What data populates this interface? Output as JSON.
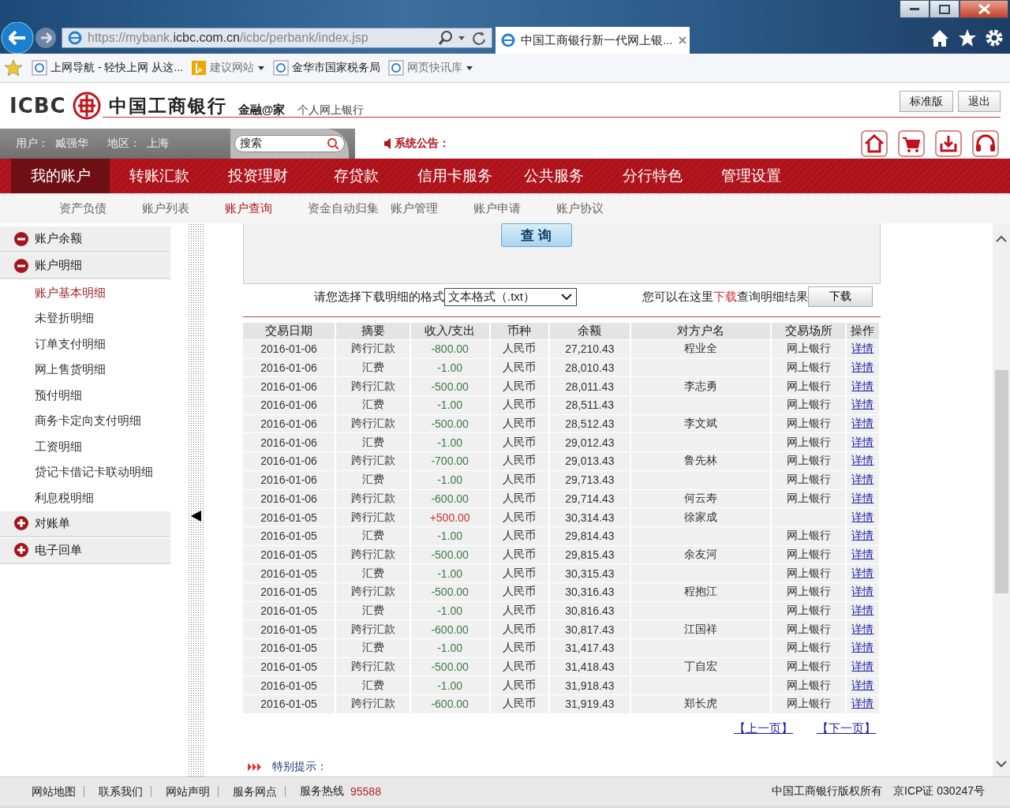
{
  "browser": {
    "url": "https://mybank.**icbc.com.cn**/icbc/perbank/index.jsp",
    "tab": "中国工商银行新一代网上银...",
    "favorites": [
      {
        "label": "上网导航 - 轻快上网 从这...",
        "dropdown": false
      },
      {
        "label": "建议网站",
        "dropdown": true
      },
      {
        "label": "金华市国家税务局",
        "dropdown": false
      },
      {
        "label": "网页快讯库",
        "dropdown": true
      }
    ]
  },
  "header": {
    "logo": "ICBC",
    "bank_name": "中国工商银行",
    "brand": "金融@家",
    "product": "个人网上银行",
    "buttons": [
      "标准版",
      "退出"
    ]
  },
  "user_bar": {
    "user_label": "用户：",
    "user": "臧强华",
    "region_label": "地区：",
    "region": "上海",
    "search_placeholder": "搜索",
    "notice": "系统公告："
  },
  "nav": [
    {
      "label": "我的账户",
      "selected": true
    },
    {
      "label": "转账汇款",
      "selected": false
    },
    {
      "label": "投资理财",
      "selected": false
    },
    {
      "label": "存贷款",
      "selected": false
    },
    {
      "label": "信用卡服务",
      "selected": false
    },
    {
      "label": "公共服务",
      "selected": false
    },
    {
      "label": "分行特色",
      "selected": false
    },
    {
      "label": "管理设置",
      "selected": false
    }
  ],
  "subnav": [
    {
      "label": "资产负债",
      "selected": false
    },
    {
      "label": "账户列表",
      "selected": false
    },
    {
      "label": "账户查询",
      "selected": true
    },
    {
      "label": "资金自动归集",
      "selected": false
    },
    {
      "label": "账户管理",
      "selected": false
    },
    {
      "label": "账户申请",
      "selected": false
    },
    {
      "label": "账户协议",
      "selected": false
    }
  ],
  "sidebar": [
    {
      "label": "账户余额",
      "expanded": true
    },
    {
      "label": "账户明细",
      "expanded": true,
      "children": [
        {
          "label": "账户基本明细",
          "selected": true
        },
        {
          "label": "未登折明细",
          "selected": false
        },
        {
          "label": "订单支付明细",
          "selected": false
        },
        {
          "label": "网上售货明细",
          "selected": false
        },
        {
          "label": "预付明细",
          "selected": false
        },
        {
          "label": "商务卡定向支付明细",
          "selected": false
        },
        {
          "label": "工资明细",
          "selected": false
        },
        {
          "label": "贷记卡借记卡联动明细",
          "selected": false
        },
        {
          "label": "利息税明细",
          "selected": false
        }
      ]
    },
    {
      "label": "对账单",
      "expanded": false
    },
    {
      "label": "电子回单",
      "expanded": false
    }
  ],
  "query": {
    "button": "查 询",
    "format_label": "请您选择下载明细的格式",
    "format": "文本格式（.txt）",
    "hint_before": "您可以在这里",
    "hint_link": "下载",
    "hint_after": "查询明细结果",
    "download_button": "下载"
  },
  "table": {
    "columns": [
      "交易日期",
      "摘要",
      "收入/支出",
      "币种",
      "余额",
      "对方户名",
      "交易场所",
      "操作"
    ],
    "rows": [
      {
        "date": "2016-01-06",
        "summary": "跨行汇款",
        "amount": "-800.00",
        "kind": "debit",
        "currency": "人民币",
        "balance": "27,210.43",
        "counterparty": "程业全",
        "place": "网上银行",
        "action": "详情"
      },
      {
        "date": "2016-01-06",
        "summary": "汇费",
        "amount": "-1.00",
        "kind": "debit",
        "currency": "人民币",
        "balance": "28,010.43",
        "place": "网上银行",
        "action": "详情"
      },
      {
        "date": "2016-01-06",
        "summary": "跨行汇款",
        "amount": "-500.00",
        "kind": "debit",
        "currency": "人民币",
        "balance": "28,011.43",
        "counterparty": "李志勇",
        "place": "网上银行",
        "action": "详情"
      },
      {
        "date": "2016-01-06",
        "summary": "汇费",
        "amount": "-1.00",
        "kind": "debit",
        "currency": "人民币",
        "balance": "28,511.43",
        "place": "网上银行",
        "action": "详情"
      },
      {
        "date": "2016-01-06",
        "summary": "跨行汇款",
        "amount": "-500.00",
        "kind": "debit",
        "currency": "人民币",
        "balance": "28,512.43",
        "counterparty": "李文斌",
        "place": "网上银行",
        "action": "详情"
      },
      {
        "date": "2016-01-06",
        "summary": "汇费",
        "amount": "-1.00",
        "kind": "debit",
        "currency": "人民币",
        "balance": "29,012.43",
        "place": "网上银行",
        "action": "详情"
      },
      {
        "date": "2016-01-06",
        "summary": "跨行汇款",
        "amount": "-700.00",
        "kind": "debit",
        "currency": "人民币",
        "balance": "29,013.43",
        "counterparty": "鲁先林",
        "place": "网上银行",
        "action": "详情"
      },
      {
        "date": "2016-01-06",
        "summary": "汇费",
        "amount": "-1.00",
        "kind": "debit",
        "currency": "人民币",
        "balance": "29,713.43",
        "place": "网上银行",
        "action": "详情"
      },
      {
        "date": "2016-01-06",
        "summary": "跨行汇款",
        "amount": "-600.00",
        "kind": "debit",
        "currency": "人民币",
        "balance": "29,714.43",
        "counterparty": "何云寿",
        "place": "网上银行",
        "action": "详情"
      },
      {
        "date": "2016-01-05",
        "summary": "跨行汇款",
        "amount": "+500.00",
        "kind": "credit",
        "currency": "人民币",
        "balance": "30,314.43",
        "counterparty": "徐家成",
        "action": "详情"
      },
      {
        "date": "2016-01-05",
        "summary": "汇费",
        "amount": "-1.00",
        "kind": "debit",
        "currency": "人民币",
        "balance": "29,814.43",
        "place": "网上银行",
        "action": "详情"
      },
      {
        "date": "2016-01-05",
        "summary": "跨行汇款",
        "amount": "-500.00",
        "kind": "debit",
        "currency": "人民币",
        "balance": "29,815.43",
        "counterparty": "余友河",
        "place": "网上银行",
        "action": "详情"
      },
      {
        "date": "2016-01-05",
        "summary": "汇费",
        "amount": "-1.00",
        "kind": "debit",
        "currency": "人民币",
        "balance": "30,315.43",
        "place": "网上银行",
        "action": "详情"
      },
      {
        "date": "2016-01-05",
        "summary": "跨行汇款",
        "amount": "-500.00",
        "kind": "debit",
        "currency": "人民币",
        "balance": "30,316.43",
        "counterparty": "程抱江",
        "place": "网上银行",
        "action": "详情"
      },
      {
        "date": "2016-01-05",
        "summary": "汇费",
        "amount": "-1.00",
        "kind": "debit",
        "currency": "人民币",
        "balance": "30,816.43",
        "place": "网上银行",
        "action": "详情"
      },
      {
        "date": "2016-01-05",
        "summary": "跨行汇款",
        "amount": "-600.00",
        "kind": "debit",
        "currency": "人民币",
        "balance": "30,817.43",
        "counterparty": "江国祥",
        "place": "网上银行",
        "action": "详情"
      },
      {
        "date": "2016-01-05",
        "summary": "汇费",
        "amount": "-1.00",
        "kind": "debit",
        "currency": "人民币",
        "balance": "31,417.43",
        "place": "网上银行",
        "action": "详情"
      },
      {
        "date": "2016-01-05",
        "summary": "跨行汇款",
        "amount": "-500.00",
        "kind": "debit",
        "currency": "人民币",
        "balance": "31,418.43",
        "counterparty": "丁自宏",
        "place": "网上银行",
        "action": "详情"
      },
      {
        "date": "2016-01-05",
        "summary": "汇费",
        "amount": "-1.00",
        "kind": "debit",
        "currency": "人民币",
        "balance": "31,918.43",
        "place": "网上银行",
        "action": "详情"
      },
      {
        "date": "2016-01-05",
        "summary": "跨行汇款",
        "amount": "-600.00",
        "kind": "debit",
        "currency": "人民币",
        "balance": "31,919.43",
        "counterparty": "郑长虎",
        "place": "网上银行",
        "action": "详情"
      }
    ]
  },
  "pager": [
    "【上一页】",
    "【下一页】"
  ],
  "notice": "特别提示：",
  "footer": {
    "links": [
      "网站地图",
      "联系我们",
      "网站声明",
      "服务网点"
    ],
    "hotline_label": "服务热线",
    "hotline": "95588",
    "copyright": "中国工商银行版权所有",
    "icp": "京ICP证 030247号"
  }
}
